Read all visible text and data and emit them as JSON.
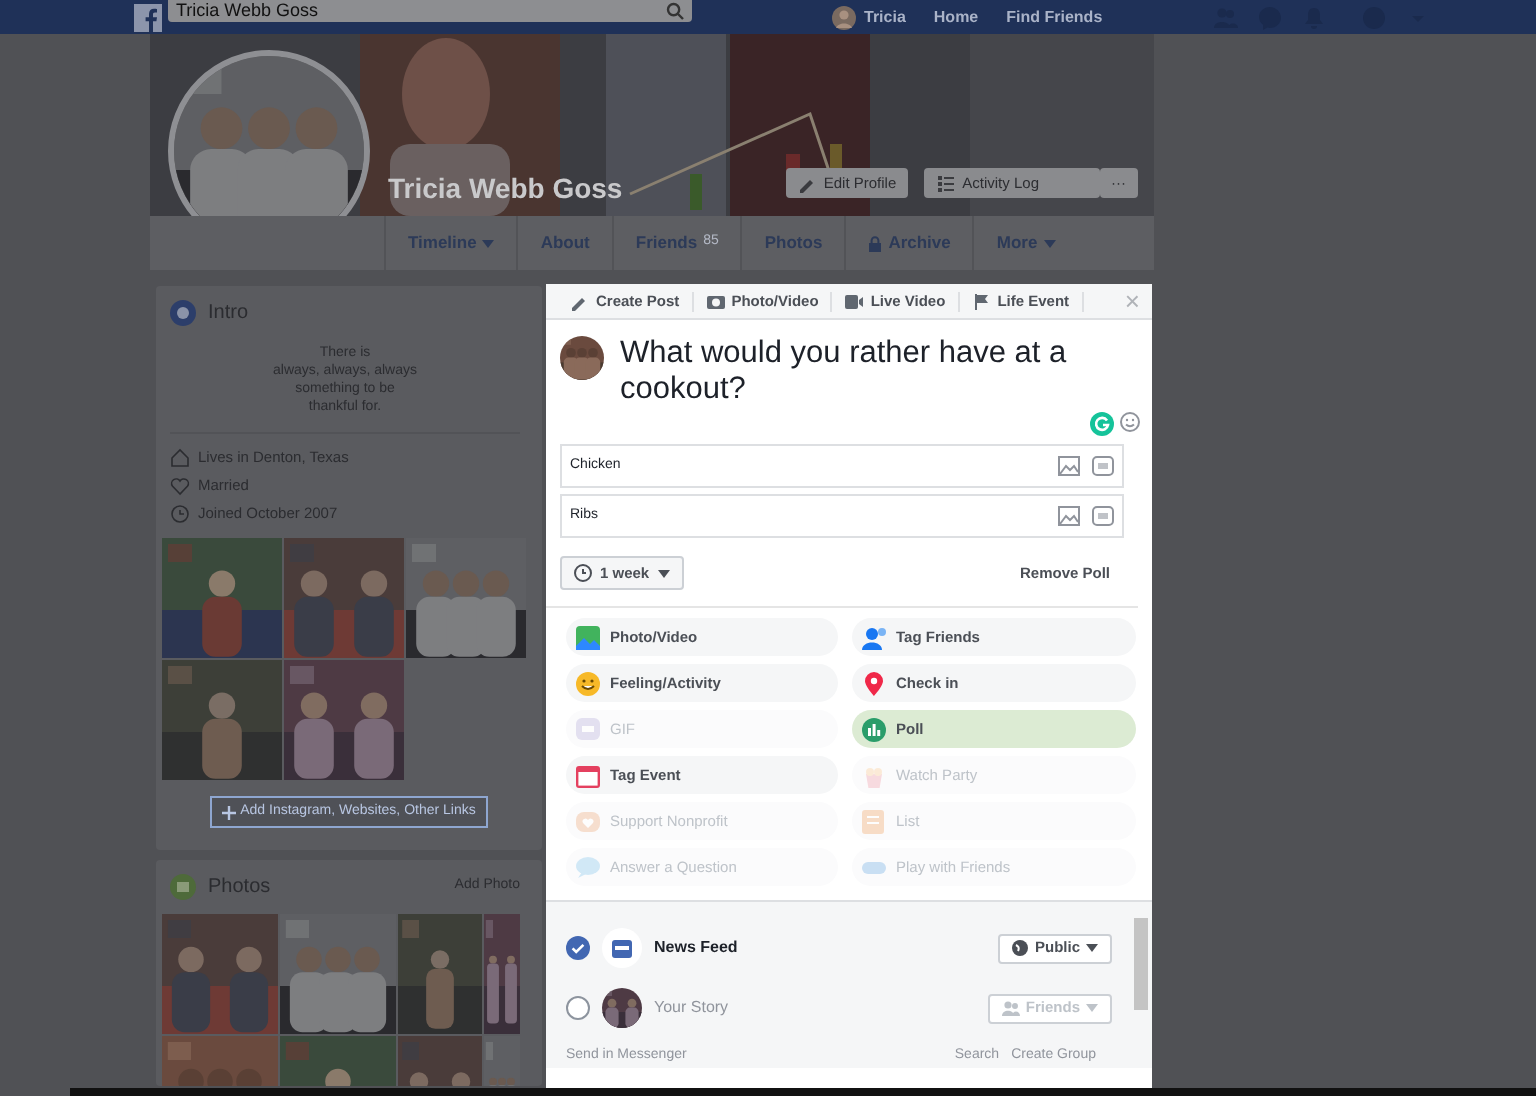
{
  "top_bar": {
    "search": {
      "value": "Tricia Webb Goss"
    },
    "user": "Tricia",
    "links": [
      "Home",
      "Find Friends"
    ]
  },
  "profile": {
    "name": "Tricia Webb Goss",
    "buttons": [
      "Edit Profile",
      "Activity Log",
      "···"
    ]
  },
  "profile_tabs": [
    {
      "label": "Timeline",
      "kind": "dropdown"
    },
    {
      "label": "About",
      "kind": "plain"
    },
    {
      "label": "Friends",
      "kind": "count",
      "count": "85"
    },
    {
      "label": "Photos",
      "kind": "plain"
    },
    {
      "label": "Archive",
      "kind": "locked"
    },
    {
      "label": "More",
      "kind": "dropdown"
    }
  ],
  "intro": {
    "title": "Intro",
    "bio": [
      "There is",
      "always, always, always",
      "something to be",
      "thankful for."
    ],
    "details": [
      "Lives in Denton, Texas",
      "Married",
      "Joined October 2007"
    ],
    "link_button": "Add Instagram, Websites, Other Links"
  },
  "photos": {
    "title": "Photos",
    "action": "Add Photo"
  },
  "composer": {
    "tabs": [
      "Create Post",
      "Photo/Video",
      "Live Video",
      "Life Event"
    ],
    "close": "×",
    "text": "What would you rather have at a cookout?",
    "options": [
      {
        "value": "Chicken"
      },
      {
        "value": "Ribs"
      }
    ],
    "duration": "1 week",
    "remove": "Remove Poll",
    "actions": [
      {
        "label": "Photo/Video",
        "disabled": false,
        "selected": false
      },
      {
        "label": "Tag Friends",
        "disabled": false,
        "selected": false
      },
      {
        "label": "Feeling/Activity",
        "disabled": false,
        "selected": false
      },
      {
        "label": "Check in",
        "disabled": false,
        "selected": false
      },
      {
        "label": "GIF",
        "disabled": true,
        "selected": false
      },
      {
        "label": "Poll",
        "disabled": false,
        "selected": true
      },
      {
        "label": "Tag Event",
        "disabled": false,
        "selected": false
      },
      {
        "label": "Watch Party",
        "disabled": true,
        "selected": false
      },
      {
        "label": "Support Nonprofit",
        "disabled": true,
        "selected": false
      },
      {
        "label": "List",
        "disabled": true,
        "selected": false
      },
      {
        "label": "Answer a Question",
        "disabled": true,
        "selected": false
      },
      {
        "label": "Play with Friends",
        "disabled": true,
        "selected": false
      }
    ],
    "audience": [
      {
        "label": "News Feed",
        "checked": true,
        "privacy": "Public"
      },
      {
        "label": "Your Story",
        "checked": false,
        "privacy": "Friends"
      }
    ],
    "messenger": {
      "label": "Send in Messenger",
      "links": [
        "Search",
        "Create Group"
      ]
    }
  }
}
